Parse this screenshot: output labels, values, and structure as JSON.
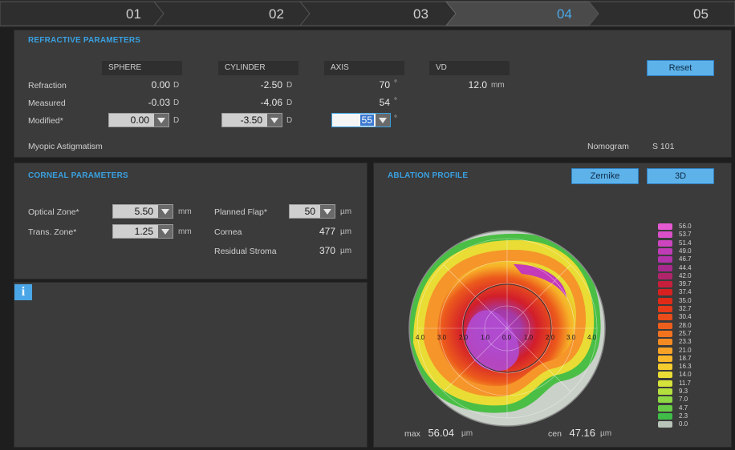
{
  "steps": [
    "01",
    "02",
    "03",
    "04",
    "05"
  ],
  "refractive": {
    "title": "REFRACTIVE PARAMETERS",
    "columns": {
      "sphere": "SPHERE",
      "cylinder": "CYLINDER",
      "axis": "AXIS",
      "vd": "VD"
    },
    "rows": {
      "refraction": {
        "label": "Refraction",
        "sphere": "0.00",
        "cylinder": "-2.50",
        "axis": "70",
        "vd": "12.0"
      },
      "measured": {
        "label": "Measured",
        "sphere": "-0.03",
        "cylinder": "-4.06",
        "axis": "54"
      },
      "modified": {
        "label": "Modified*",
        "sphere": "0.00",
        "cylinder": "-3.50",
        "axis": "55"
      }
    },
    "units": {
      "d": "D",
      "deg": "°",
      "mm": "mm"
    },
    "reset": "Reset",
    "diagnosis": "Myopic Astigmatism",
    "nomogram_label": "Nomogram",
    "nomogram_value": "S 101"
  },
  "corneal": {
    "title": "CORNEAL PARAMETERS",
    "optical_zone": {
      "label": "Optical Zone*",
      "value": "5.50",
      "unit": "mm"
    },
    "trans_zone": {
      "label": "Trans. Zone*",
      "value": "1.25",
      "unit": "mm"
    },
    "planned_flap": {
      "label": "Planned Flap*",
      "value": "50",
      "unit": "µm"
    },
    "cornea": {
      "label": "Cornea",
      "value": "477",
      "unit": "µm"
    },
    "residual_stroma": {
      "label": "Residual Stroma",
      "value": "370",
      "unit": "µm"
    }
  },
  "info": {
    "icon": "info-icon",
    "glyph": "i"
  },
  "ablation": {
    "title": "ABLATION PROFILE",
    "zernike": "Zernike",
    "threed": "3D",
    "axis_ticks": [
      "4.0",
      "3.0",
      "2.0",
      "1.0",
      "0.0",
      "1.0",
      "2.0",
      "3.0",
      "4.0"
    ],
    "max_label": "max",
    "max_value": "56.04",
    "cen_label": "cen",
    "cen_value": "47.16",
    "unit": "µm",
    "legend": [
      {
        "v": "56.0",
        "c": "#e55ad2"
      },
      {
        "v": "53.7",
        "c": "#d94fc8"
      },
      {
        "v": "51.4",
        "c": "#cc45bf"
      },
      {
        "v": "49.0",
        "c": "#bf3cb6"
      },
      {
        "v": "46.7",
        "c": "#b233ab"
      },
      {
        "v": "44.4",
        "c": "#a82a8c"
      },
      {
        "v": "42.0",
        "c": "#b0246a"
      },
      {
        "v": "39.7",
        "c": "#c61f3c"
      },
      {
        "v": "37.4",
        "c": "#d92020"
      },
      {
        "v": "35.0",
        "c": "#e02a18"
      },
      {
        "v": "32.7",
        "c": "#e63a18"
      },
      {
        "v": "30.4",
        "c": "#ea4c1a"
      },
      {
        "v": "28.0",
        "c": "#ee5e1c"
      },
      {
        "v": "25.7",
        "c": "#f2731e"
      },
      {
        "v": "23.3",
        "c": "#f58a22"
      },
      {
        "v": "21.0",
        "c": "#f7a226"
      },
      {
        "v": "18.7",
        "c": "#f8b82a"
      },
      {
        "v": "16.3",
        "c": "#f4cc2e"
      },
      {
        "v": "14.0",
        "c": "#e9dc34"
      },
      {
        "v": "11.7",
        "c": "#d4e23a"
      },
      {
        "v": "9.3",
        "c": "#b4e03e"
      },
      {
        "v": "7.0",
        "c": "#8ed844"
      },
      {
        "v": "4.7",
        "c": "#66cc46"
      },
      {
        "v": "2.3",
        "c": "#3fbd48"
      },
      {
        "v": "0.0",
        "c": "#b8c4b8"
      }
    ]
  }
}
